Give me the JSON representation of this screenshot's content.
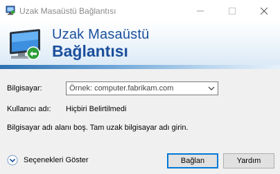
{
  "window": {
    "title": "Uzak Masaüstü Bağlantısı",
    "controls": {
      "minimize": "minimize-icon",
      "maximize": "maximize-icon",
      "close": "close-icon"
    }
  },
  "banner": {
    "line1": "Uzak Masaüstü",
    "line2": "Bağlantısı",
    "icon": "remote-desktop-monitor-icon",
    "colors": {
      "title": "#1b4f9c",
      "band": "#2b6fb0"
    }
  },
  "form": {
    "computer_label": "Bilgisayar:",
    "computer_value": "Örnek: computer.fabrikam.com",
    "user_label": "Kullanıcı adı:",
    "user_value": "Hiçbiri Belirtilmedi",
    "message": "Bilgisayar adı alanı boş. Tam uzak bilgisayar adı girin."
  },
  "footer": {
    "show_options": "Seçenekleri Göster",
    "connect_button": "Bağlan",
    "help_button": "Yardım"
  }
}
